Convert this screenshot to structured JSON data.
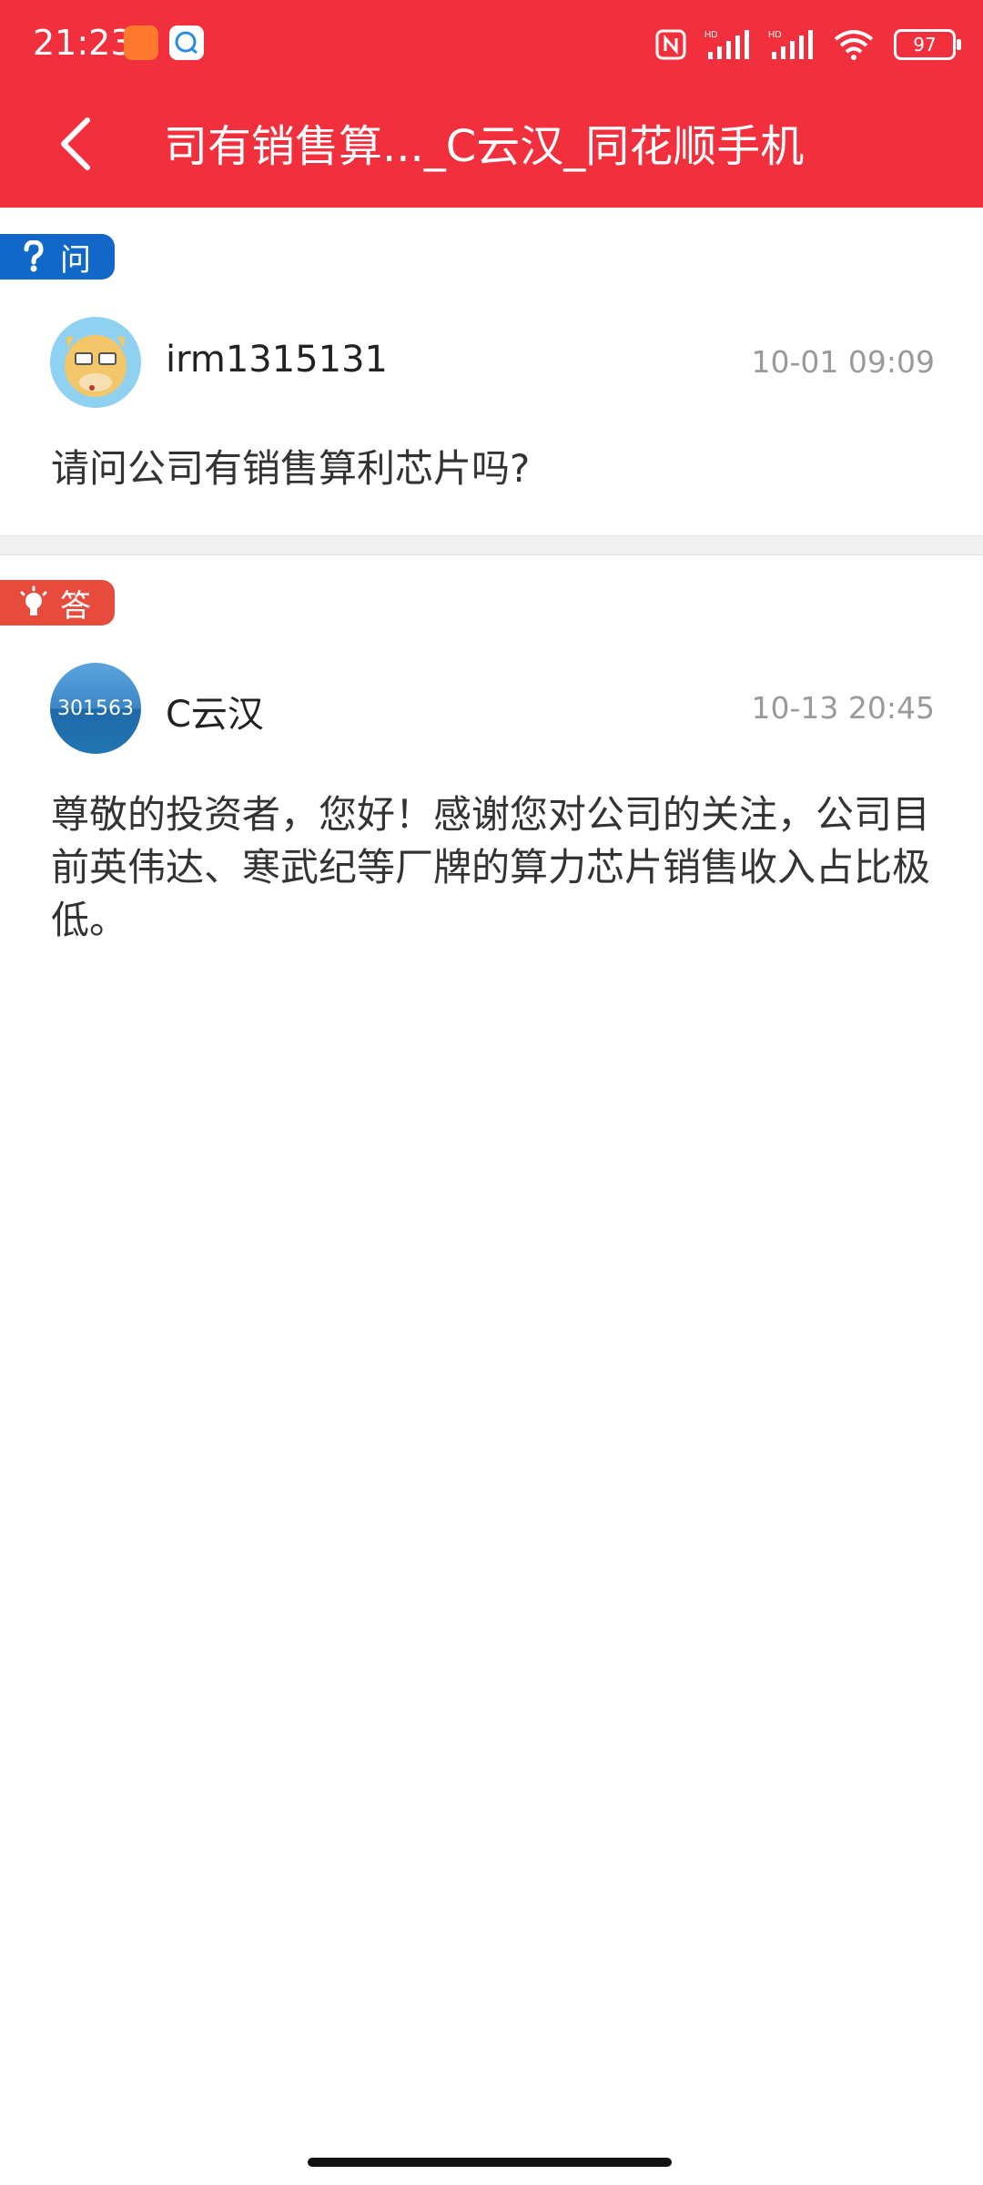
{
  "status_bar": {
    "time": "21:23",
    "battery": "97",
    "icons": [
      "shop-notification-icon",
      "message-notification-icon",
      "nfc-icon",
      "signal-hd-icon",
      "signal-hd-icon",
      "wifi-icon",
      "battery-icon"
    ]
  },
  "header": {
    "title": "司有销售算..._C云汉_同花顺手机",
    "back_icon": "chevron-left-icon",
    "color": "#f2303d"
  },
  "question": {
    "tag": "问",
    "tag_color": "#1168c8",
    "user": "irm1315131",
    "time": "10-01 09:09",
    "text": "请问公司有销售算利芯片吗?"
  },
  "answer": {
    "tag": "答",
    "tag_color": "#e64b3c",
    "avatar_text": "301563",
    "user": "C云汉",
    "time": "10-13 20:45",
    "text": "尊敬的投资者，您好！感谢您对公司的关注，公司目前英伟达、寒武纪等厂牌的算力芯片销售收入占比极低。"
  }
}
